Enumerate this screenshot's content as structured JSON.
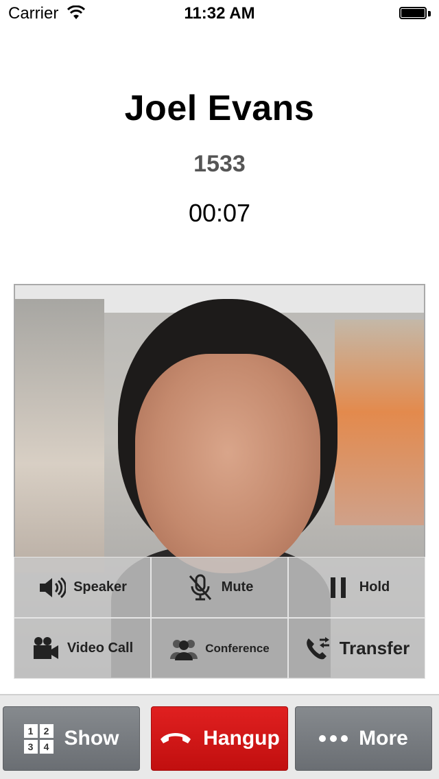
{
  "status_bar": {
    "carrier": "Carrier",
    "time": "11:32 AM",
    "wifi_icon": "wifi-icon",
    "battery_icon": "battery-icon"
  },
  "call": {
    "caller_name": "Joel Evans",
    "extension": "1533",
    "duration": "00:07"
  },
  "controls": [
    {
      "label": "Speaker",
      "icon": "speaker-icon"
    },
    {
      "label": "Mute",
      "icon": "mic-off-icon"
    },
    {
      "label": "Hold",
      "icon": "pause-icon"
    },
    {
      "label": "Video Call",
      "icon": "video-camera-icon"
    },
    {
      "label": "Conference",
      "icon": "conference-icon"
    },
    {
      "label": "Transfer",
      "icon": "transfer-icon"
    }
  ],
  "toolbar": {
    "show_label": "Show",
    "hangup_label": "Hangup",
    "more_label": "More",
    "keypad_digits": [
      "1",
      "2",
      "3",
      "4"
    ]
  },
  "colors": {
    "hangup": "#d01414",
    "toolbar_button": "#777b80",
    "control_overlay": "#c8c8c8"
  }
}
